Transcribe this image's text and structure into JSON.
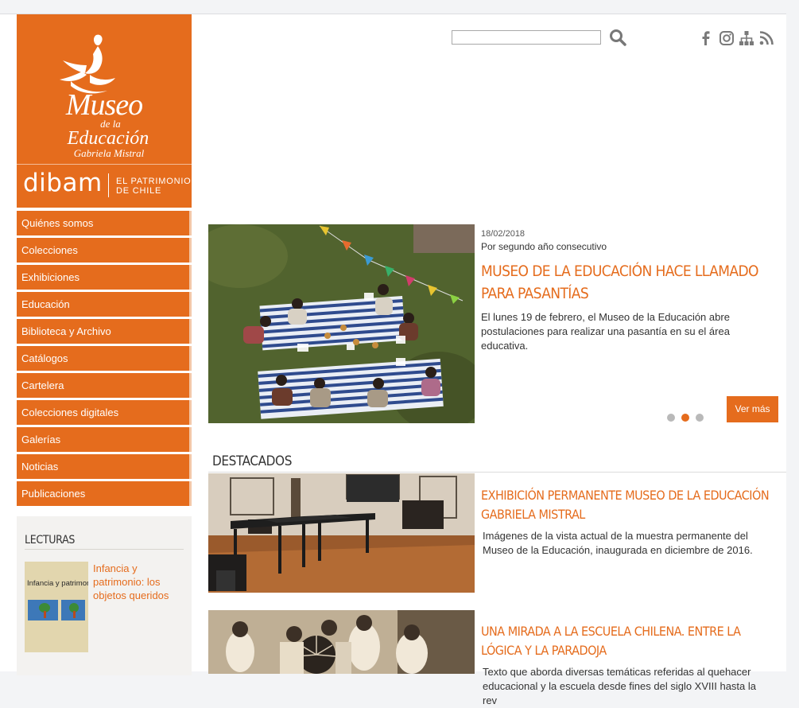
{
  "brand": {
    "museo_line1": "Museo",
    "museo_line2": "de la",
    "museo_line3": "Educación",
    "museo_line4": "Gabriela Mistral",
    "dibam": "dibam",
    "dibam_line1": "EL PATRIMONIO",
    "dibam_line2": "DE CHILE",
    "accent_color": "#e56c1d"
  },
  "search": {
    "placeholder": "",
    "value": "",
    "icon": "search-icon"
  },
  "social": [
    "facebook-icon",
    "instagram-icon",
    "sitemap-icon",
    "rss-icon"
  ],
  "nav": {
    "items": [
      "Quiénes somos",
      "Colecciones",
      "Exhibiciones",
      "Educación",
      "Biblioteca y Archivo",
      "Catálogos",
      "Cartelera",
      "Colecciones digitales",
      "Galerías",
      "Noticias",
      "Publicaciones"
    ]
  },
  "lecturas": {
    "title": "LECTURAS",
    "book_cover_text": "Infancia y patrimonio",
    "book_link": "Infancia y patrimonio: los objetos queridos"
  },
  "slider": {
    "date": "18/02/2018",
    "subtitle": "Por segundo año consecutivo",
    "title": "MUSEO DE LA EDUCACIÓN HACE LLAMADO PARA PASANTÍAS",
    "text": "El lunes 19 de febrero, el Museo de la Educación abre postulaciones para realizar una pasantía en su el área educativa.",
    "button": "Ver más",
    "dots": 3,
    "active_dot": 2
  },
  "destacados": {
    "title": "DESTACADOS",
    "articles": [
      {
        "title": "EXHIBICIÓN PERMANENTE MUSEO DE LA EDUCACIÓN GABRIELA MISTRAL",
        "text": "Imágenes de la vista actual de la muestra permanente del Museo de la Educación, inaugurada en diciembre de 2016."
      },
      {
        "title": "UNA MIRADA A LA ESCUELA CHILENA. ENTRE LA LÓGICA Y LA PARADOJA",
        "text": "Texto que aborda diversas temáticas referidas al quehacer educacional y la escuela desde fines del siglo XVIII hasta la rev"
      }
    ]
  }
}
